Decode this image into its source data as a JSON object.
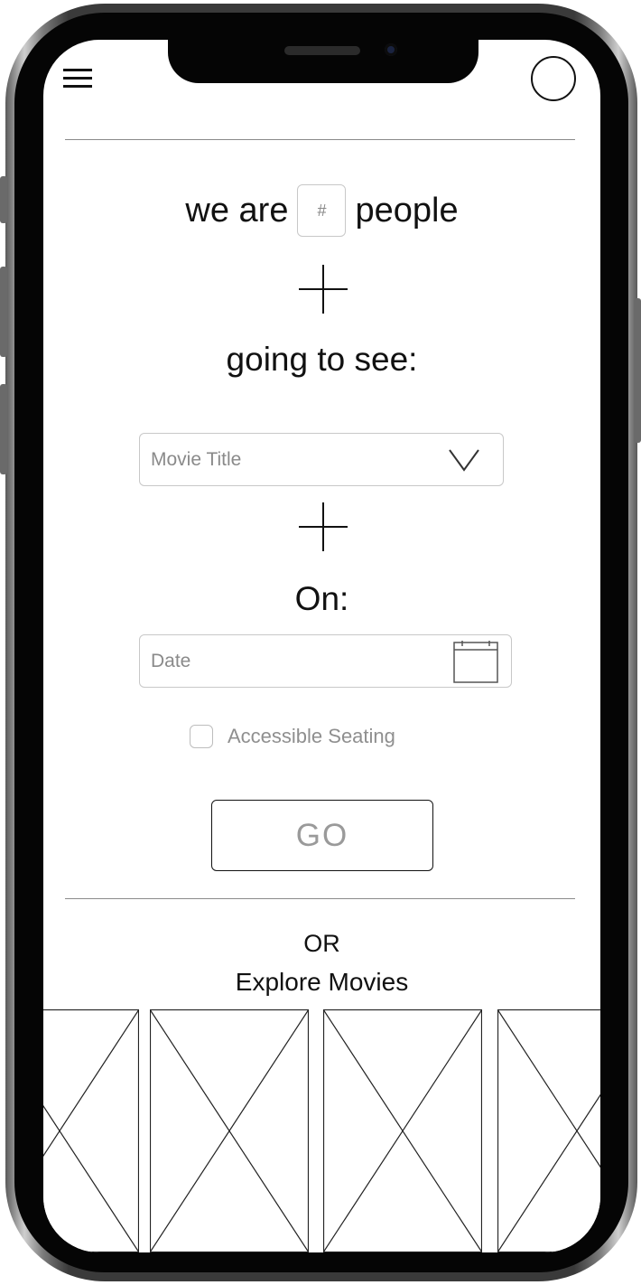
{
  "header": {
    "menu_icon": "hamburger-menu-icon",
    "avatar_icon": "profile-avatar-icon"
  },
  "form": {
    "people_prefix": "we are",
    "people_placeholder": "#",
    "people_suffix": "people",
    "plus_icon": "plus-icon",
    "movie_heading": "going to see:",
    "movie_placeholder": "Movie Title",
    "movie_dropdown_icon": "chevron-down-icon",
    "date_heading": "On:",
    "date_placeholder": "Date",
    "date_icon": "calendar-icon",
    "accessible_label": "Accessible Seating",
    "accessible_checked": false,
    "go_label": "GO"
  },
  "explore": {
    "or_label": "OR",
    "title": "Explore Movies",
    "tiles": [
      {
        "name": "movie-thumbnail-placeholder"
      },
      {
        "name": "movie-thumbnail-placeholder"
      },
      {
        "name": "movie-thumbnail-placeholder"
      },
      {
        "name": "movie-thumbnail-placeholder"
      }
    ]
  },
  "colors": {
    "text": "#111111",
    "placeholder": "#8a8a8a",
    "border": "#c8c8c8",
    "divider": "#8a8a8a",
    "button_text": "#9a9a9a"
  }
}
